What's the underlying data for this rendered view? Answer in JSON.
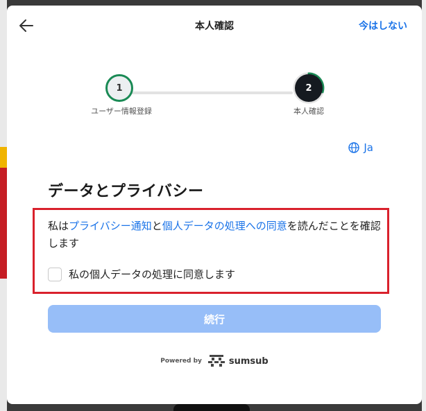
{
  "header": {
    "title": "本人確認",
    "skip_label": "今はしない"
  },
  "stepper": {
    "steps": [
      {
        "number": "1",
        "label": "ユーザー情報登録"
      },
      {
        "number": "2",
        "label": "本人確認"
      }
    ]
  },
  "language": {
    "label": "Ja"
  },
  "main": {
    "heading": "データとプライバシー",
    "consent": {
      "prefix": "私は",
      "link1": "プライバシー通知",
      "and": "と",
      "link2": "個人データの処理への同意",
      "suffix": "を読んだことを確認します"
    },
    "checkbox_label": "私の個人データの処理に同意します",
    "checkbox_checked": false,
    "continue_label": "続行"
  },
  "footer": {
    "powered_by": "Powered by",
    "brand": "sumsub"
  },
  "colors": {
    "accent": "#1a73e8",
    "step_complete": "#1a8a55",
    "highlight_border": "#d9212c",
    "button_disabled": "#97bef8"
  },
  "icons": {
    "back": "arrow-left-icon",
    "language": "globe-icon",
    "brand": "sumsub-logo-icon"
  }
}
